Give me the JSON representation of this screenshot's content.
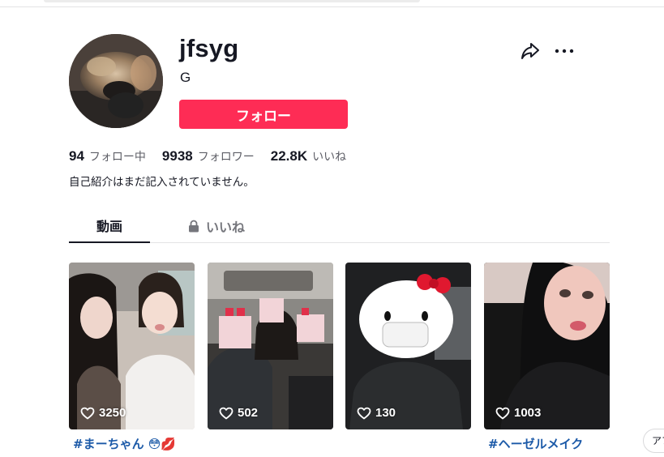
{
  "profile": {
    "username": "jfsyg",
    "nickname": "G",
    "follow_label": "フォロー",
    "bio": "自己紹介はまだ記入されていません。"
  },
  "stats": {
    "following_count": "94",
    "following_label": "フォロー中",
    "followers_count": "9938",
    "followers_label": "フォロワー",
    "likes_count": "22.8K",
    "likes_label": "いいね"
  },
  "tabs": {
    "videos": "動画",
    "liked": "いいね"
  },
  "videos": [
    {
      "count": "3250",
      "caption": "#まーちゃん 😳💋"
    },
    {
      "count": "502",
      "caption": ""
    },
    {
      "count": "130",
      "caption": ""
    },
    {
      "count": "1003",
      "caption": "#ヘーゼルメイク"
    }
  ],
  "translate_chip": "アプ",
  "colors": {
    "accent": "#fe2c55",
    "hashtag": "#1c5aa8",
    "text": "#161823",
    "muted": "#5d5e66"
  },
  "icons": {
    "share": "share-arrow-icon",
    "more": "more-dots-icon",
    "lock": "lock-icon",
    "heart": "heart-outline-icon"
  }
}
